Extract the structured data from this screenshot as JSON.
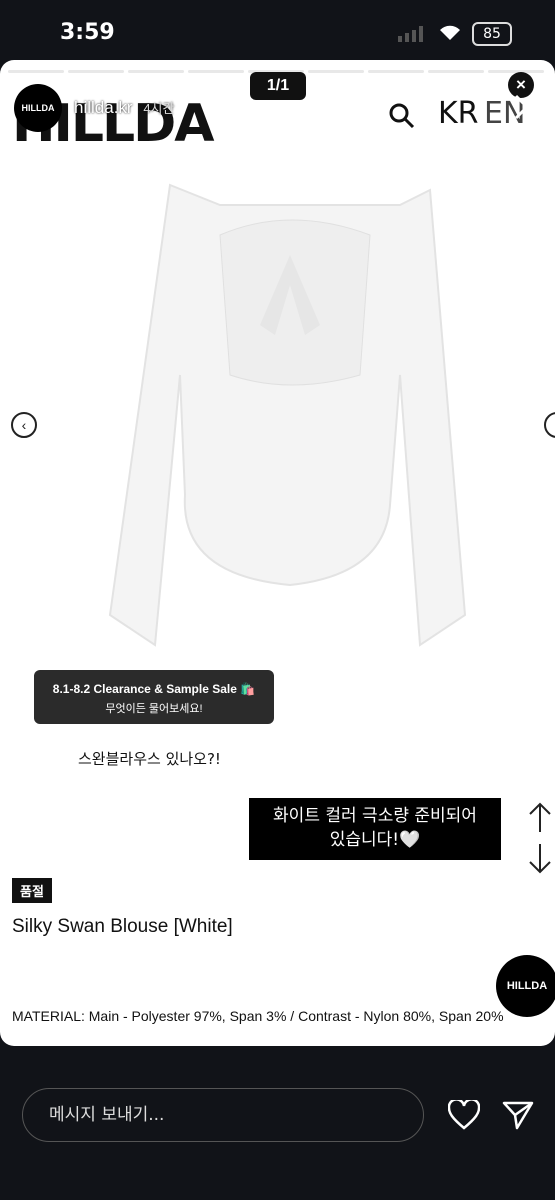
{
  "status_bar": {
    "time": "3:59",
    "battery": "85"
  },
  "story": {
    "username": "hillda.kr",
    "time_ago": "4시간",
    "page_counter": "1/1",
    "dismiss_symbol": "×",
    "avatar_text": "HILLDA",
    "progress_segments": 9
  },
  "site_header": {
    "logo": "HILLDA",
    "lang_kr": "KR",
    "lang_en": "EN"
  },
  "stickers": {
    "sale_line1": "8.1-8.2 Clearance & Sample Sale 🛍️",
    "sale_line2": "무엇이든 물어보세요!",
    "question": "스완블라우스 있나오?!",
    "reply_line1": "화이트 컬러 극소량 준비되어",
    "reply_line2": "있습니다!🤍"
  },
  "product": {
    "soldout_badge": "품절",
    "name": "Silky Swan Blouse [White]",
    "material": "MATERIAL: Main - Polyester 97%, Span 3% /  Contrast - Nylon 80%, Span 20%",
    "float_badge": "HILLDA"
  },
  "composer": {
    "placeholder": "메시지 보내기..."
  },
  "icons": [
    "search-icon",
    "close-icon",
    "arrow-left-icon",
    "arrow-right-icon",
    "arrow-up-icon",
    "arrow-down-icon",
    "heart-icon",
    "send-icon",
    "dismiss-icon"
  ]
}
